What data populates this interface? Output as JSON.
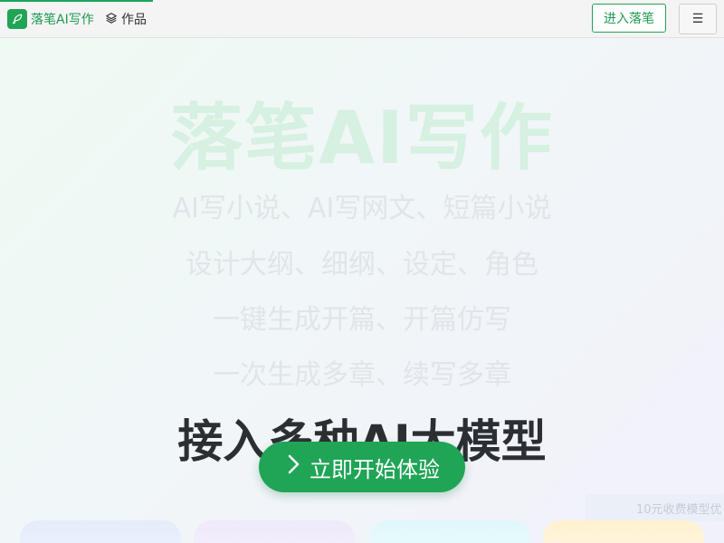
{
  "header": {
    "brand_name": "落笔AI写作",
    "works_label": "作品",
    "enter_button_label": "进入落笔",
    "menu_icon": "☰"
  },
  "hero": {
    "title": "落笔AI写作",
    "features": [
      "AI写小说、AI写网文、短篇小说",
      "设计大纲、细纲、设定、角色",
      "一键生成开篇、开篇仿写",
      "一次生成多章、续写多章"
    ],
    "models_heading": "接入多种AI大模型",
    "cta_label": "立即开始体验"
  },
  "promo": {
    "text": "10元收费模型优"
  },
  "colors": {
    "brand_green": "#20a456",
    "title_tint": "#d6f0e1",
    "feature_text": "#dfe5e8",
    "heading_dark": "#2b2f33"
  },
  "icons": {
    "brand": "feather-icon",
    "works": "layers-icon",
    "menu": "hamburger-menu-icon",
    "cta": "chevron-right-icon"
  }
}
